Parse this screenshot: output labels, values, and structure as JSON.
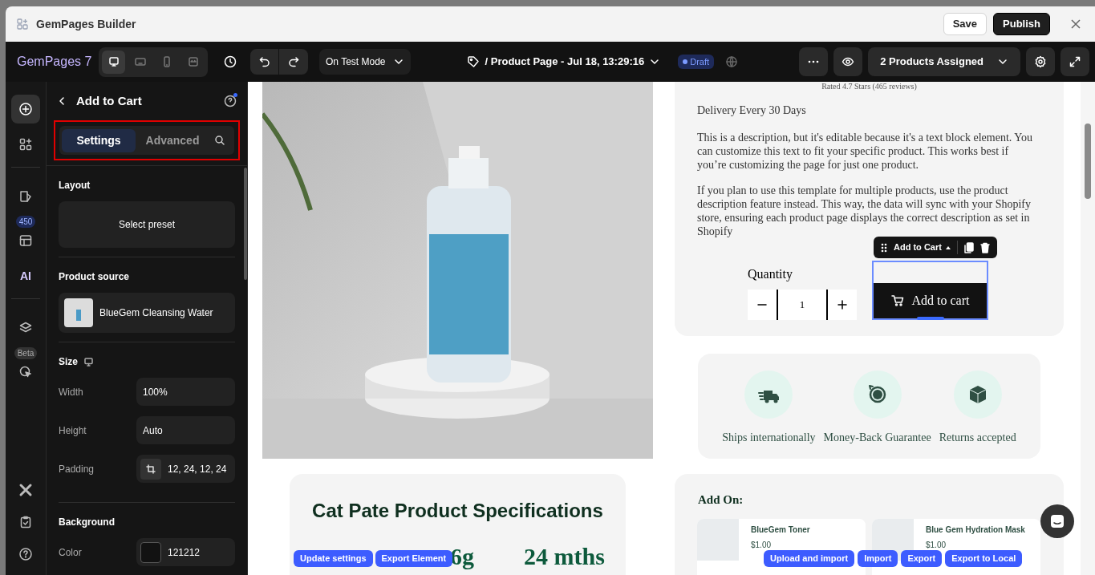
{
  "window": {
    "title": "GemPages Builder",
    "buttons": [
      {
        "label": "Save",
        "kind": "secondary"
      },
      {
        "label": "Publish",
        "kind": "primary"
      }
    ]
  },
  "toolbar": {
    "logo": "GemPages 7",
    "devices": [
      {
        "kind": "desktop",
        "selected": true
      },
      {
        "kind": "tablet",
        "selected": false
      },
      {
        "kind": "mobile",
        "selected": false
      },
      {
        "kind": "fit",
        "selected": false
      }
    ],
    "mode": "On Test Mode",
    "page_title": "/ Product Page - Jul 18, 13:29:16",
    "status": "Draft",
    "assigned": "2 Products Assigned"
  },
  "rail": {
    "items": [
      {
        "kind": "add",
        "selected": true
      },
      {
        "kind": "elements",
        "selected": false
      },
      {
        "kind": "pages",
        "selected": false
      },
      {
        "kind": "templates",
        "badge": "450",
        "selected": false
      },
      {
        "kind": "ai",
        "label": "AI",
        "selected": false
      },
      {
        "kind": "layers",
        "selected": false
      },
      {
        "kind": "cursor",
        "badge": "Beta",
        "selected": false
      }
    ],
    "bottom": [
      {
        "kind": "x-logo"
      },
      {
        "kind": "checklist"
      },
      {
        "kind": "help"
      }
    ]
  },
  "panel": {
    "title": "Add to Cart",
    "tabs": [
      {
        "label": "Settings",
        "selected": true
      },
      {
        "label": "Advanced",
        "selected": false
      }
    ],
    "sections": [
      {
        "kind": "preset",
        "title": "Layout",
        "value": "Select preset"
      },
      {
        "kind": "product",
        "title": "Product source",
        "value": "BlueGem Cleansing Water"
      },
      {
        "kind": "fields",
        "title": "Size",
        "fields": [
          {
            "kind": "text",
            "label": "Width",
            "value": "100%"
          },
          {
            "kind": "text",
            "label": "Height",
            "value": "Auto"
          },
          {
            "kind": "padding",
            "label": "Padding",
            "value": "12, 24, 12, 24"
          }
        ]
      },
      {
        "kind": "fields",
        "title": "Background",
        "fields": [
          {
            "kind": "color",
            "label": "Color",
            "value": "121212"
          }
        ]
      }
    ]
  },
  "product_info": {
    "rating": "Rated 4.7 Stars (465 reviews)",
    "delivery": "Delivery Every 30 Days",
    "paragraphs": [
      "This is a description, but it's editable because it's a text block element. You can customize this text to fit your specific product. This works best if you’re customizing the page for just one product.",
      "If you plan to use this template for multiple products, use the product description feature instead. This way, the data will sync with your Shopify store, ensuring each product page displays the correct description as set in Shopify"
    ],
    "quantity_label": "Quantity",
    "quantity": "1",
    "add_to_cart": "Add to cart",
    "element_toolbar": "Add to Cart"
  },
  "features": [
    {
      "kind": "truck",
      "label": "Ships internationally"
    },
    {
      "kind": "money-back",
      "label": "Money-Back Guarantee"
    },
    {
      "kind": "box",
      "label": "Returns accepted"
    }
  ],
  "specs": {
    "title": "Cat Pate Product Specifications",
    "values": [
      "6g",
      "24 mths"
    ]
  },
  "add_on": {
    "title": "Add On:",
    "products": [
      {
        "name": "BlueGem Toner",
        "price": "$1.00"
      },
      {
        "name": "Blue Gem Hydration Mask",
        "price": "$1.00"
      }
    ]
  },
  "actions": {
    "left": [
      "Update settings",
      "Export Element"
    ],
    "right": [
      "Upload and import",
      "Import",
      "Export",
      "Export to Local"
    ]
  }
}
